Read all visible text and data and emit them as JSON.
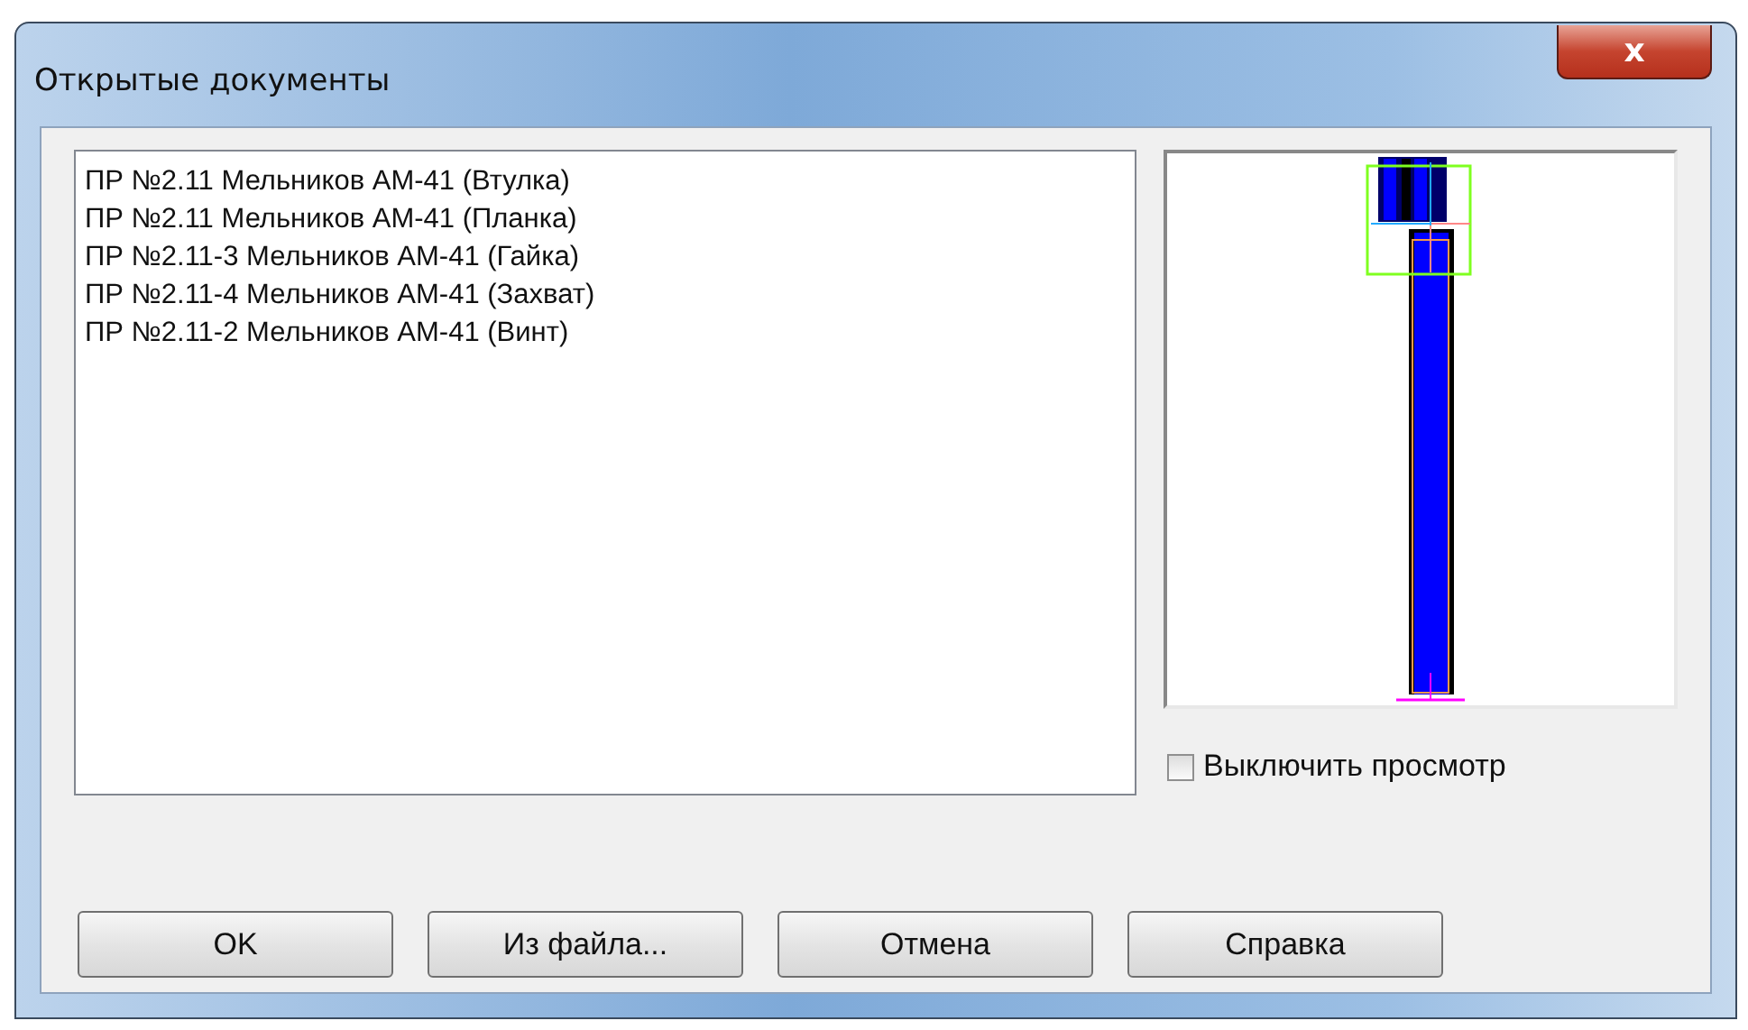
{
  "window": {
    "title": "Открытые документы",
    "close": "x"
  },
  "documents": [
    {
      "label": "ПР №2.11 Мельников АМ-41 (Втулка)",
      "selected": false
    },
    {
      "label": "ПР №2.11 Мельников АМ-41 (Планка)",
      "selected": false
    },
    {
      "label": "ПР №2.11-3 Мельников АМ-41 (Гайка)",
      "selected": false
    },
    {
      "label": "ПР №2.11-4 Мельников АМ-41 (Захват)",
      "selected": false
    },
    {
      "label": "ПР №2.11-2 Мельников АМ-41 (Винт)",
      "selected": false
    }
  ],
  "preview_off": {
    "label": "Выключить просмотр",
    "checked": false
  },
  "buttons": [
    "OK",
    "Из файла...",
    "Отмена",
    "Справка"
  ]
}
